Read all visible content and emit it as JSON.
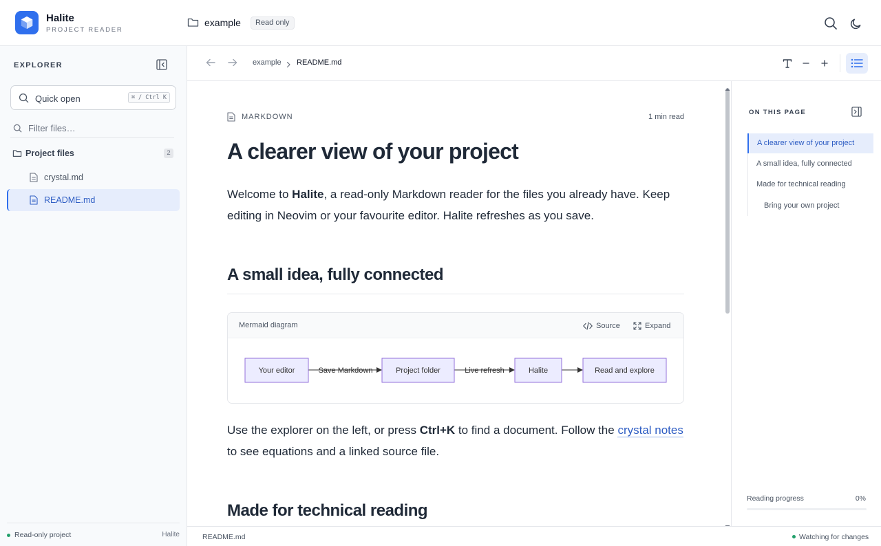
{
  "header": {
    "app_title": "Halite",
    "app_subtitle": "PROJECT READER",
    "project_name": "example",
    "mode_badge": "Read only"
  },
  "sidebar": {
    "title": "EXPLORER",
    "quick_open_label": "Quick open",
    "quick_open_shortcut": "⌘ / Ctrl K",
    "filter_placeholder": "Filter files…",
    "group": {
      "label": "Project files",
      "count": "2"
    },
    "files": [
      {
        "label": "crystal.md",
        "active": false
      },
      {
        "label": "README.md",
        "active": true
      }
    ],
    "footer_status": "Read-only project",
    "footer_brand": "Halite"
  },
  "toolbar": {
    "crumbs": [
      "example",
      "README.md"
    ]
  },
  "doc": {
    "type_label": "MARKDOWN",
    "read_time": "1 min read",
    "title": "A clearer view of your project",
    "intro": {
      "before": "Welcome to ",
      "bold": "Halite",
      "after": ", a read-only Markdown reader for the files you already have. Keep editing in Neovim or your favourite editor. Halite refreshes as you save."
    },
    "section1": "A small idea, fully connected",
    "mermaid": {
      "title": "Mermaid diagram",
      "source_label": "Source",
      "expand_label": "Expand",
      "nodes": [
        "Your editor",
        "Project folder",
        "Halite",
        "Read and explore"
      ],
      "edges": [
        "Save Markdown",
        "Live refresh",
        ""
      ]
    },
    "para2": {
      "before": "Use the explorer on the left, or press ",
      "bold": "Ctrl+K",
      "middle": " to find a document. Follow the ",
      "link": "crystal notes",
      "after": " to see equations and a linked source file."
    },
    "section2": "Made for technical reading"
  },
  "toc": {
    "title": "ON THIS PAGE",
    "items": [
      {
        "label": "A clearer view of your project",
        "active": true,
        "level": 1
      },
      {
        "label": "A small idea, fully connected",
        "active": false,
        "level": 2
      },
      {
        "label": "Made for technical reading",
        "active": false,
        "level": 2
      },
      {
        "label": "Bring your own project",
        "active": false,
        "level": 3
      }
    ],
    "progress_label": "Reading progress",
    "progress_value": "0%",
    "progress_fraction": 0
  },
  "statusbar": {
    "file": "README.md",
    "watch_status": "Watching for changes"
  },
  "colors": {
    "accent": "#2f6fed",
    "node_fill": "#ECECFF",
    "node_stroke": "#9370DB",
    "status_ok": "#22a06b"
  }
}
